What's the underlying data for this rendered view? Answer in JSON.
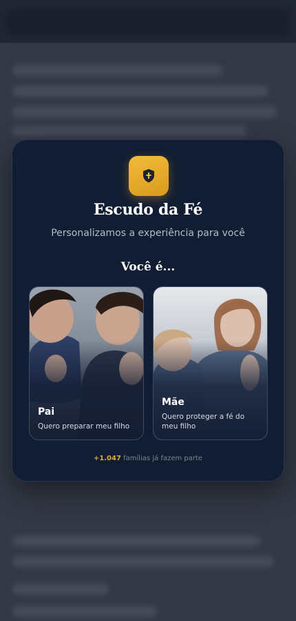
{
  "app": {
    "name": "Escudo da Fé",
    "subtitle": "Personalizamos a experiência para você"
  },
  "question": "Você é...",
  "options": [
    {
      "title": "Pai",
      "description": "Quero preparar meu filho",
      "image": "father-and-child-praying"
    },
    {
      "title": "Mãe",
      "description": "Quero proteger a fé do meu filho",
      "image": "mother-and-child-praying"
    }
  ],
  "footer": {
    "count": "+1.047",
    "text": " famílias já fazem parte"
  },
  "icons": {
    "logo": "shield-cross-icon"
  },
  "colors": {
    "accent": "#e8a72a",
    "modal_bg": "#111d33",
    "backdrop": "#3b404e"
  }
}
